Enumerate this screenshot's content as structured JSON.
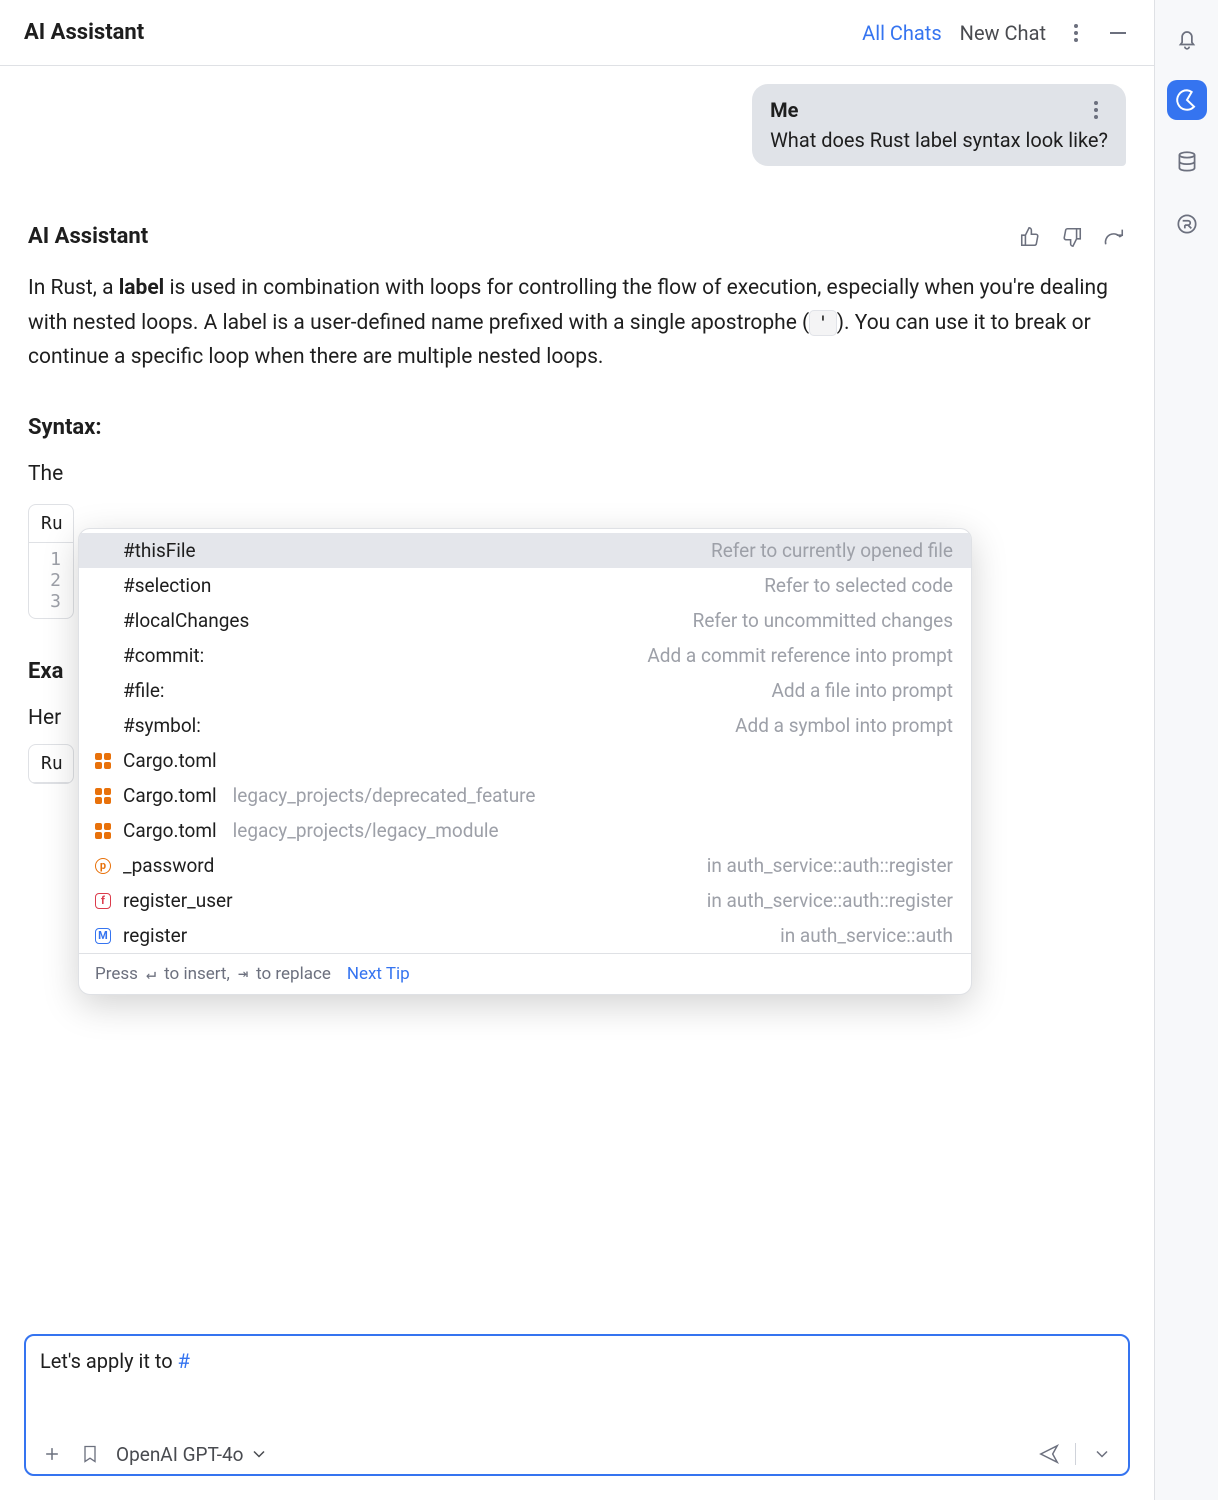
{
  "header": {
    "title": "AI Assistant",
    "all_chats": "All Chats",
    "new_chat": "New Chat"
  },
  "conversation": {
    "user_sender": "Me",
    "user_text": "What does Rust label syntax look like?",
    "assistant_name": "AI Assistant",
    "assistant_para_pre": "In Rust, a ",
    "assistant_para_bold": "label",
    "assistant_para_mid": " is used in combination with loops for controlling the flow of execution, especially when you're dealing with nested loops. A label is a user-defined name prefixed with a single apostrophe (",
    "assistant_para_code": "'",
    "assistant_para_post": "). You can use it to break or continue a specific loop when there are multiple nested loops.",
    "syntax_heading": "Syntax:",
    "syntax_intro_trunc": "The",
    "code_tab_trunc": "Ru",
    "code_line_1": "1",
    "code_line_2": "2",
    "code_line_3": "3",
    "example_heading_trunc": "Exa",
    "example_intro_trunc": "Her",
    "code_tab2_trunc": "Ru"
  },
  "popup": {
    "items": [
      {
        "label": "#thisFile",
        "desc": "Refer to currently opened file",
        "icon": "",
        "selected": true
      },
      {
        "label": "#selection",
        "desc": "Refer to selected code",
        "icon": "",
        "selected": false
      },
      {
        "label": "#localChanges",
        "desc": "Refer to uncommitted changes",
        "icon": "",
        "selected": false
      },
      {
        "label": "#commit:",
        "desc": "Add a commit reference into prompt",
        "icon": "",
        "selected": false
      },
      {
        "label": "#file:",
        "desc": "Add a file into prompt",
        "icon": "",
        "selected": false
      },
      {
        "label": "#symbol:",
        "desc": "Add a symbol into prompt",
        "icon": "",
        "selected": false
      },
      {
        "label": "Cargo.toml",
        "sub": "",
        "desc": "",
        "icon": "toml"
      },
      {
        "label": "Cargo.toml",
        "sub": "legacy_projects/deprecated_feature",
        "desc": "",
        "icon": "toml"
      },
      {
        "label": "Cargo.toml",
        "sub": "legacy_projects/legacy_module",
        "desc": "",
        "icon": "toml"
      },
      {
        "label": "_password",
        "desc": "in auth_service::auth::register",
        "icon": "param"
      },
      {
        "label": "register_user",
        "desc": "in auth_service::auth::register",
        "icon": "fn"
      },
      {
        "label": "register",
        "desc": "in auth_service::auth",
        "icon": "mod"
      }
    ],
    "footer_pre": "Press ",
    "footer_enter": "↵",
    "footer_mid": " to insert, ",
    "footer_tab": "⇥",
    "footer_post": " to replace",
    "next_tip": "Next Tip"
  },
  "input": {
    "typed_pre": "Let's apply it to ",
    "typed_hash": "#",
    "model": "OpenAI GPT-4o"
  }
}
